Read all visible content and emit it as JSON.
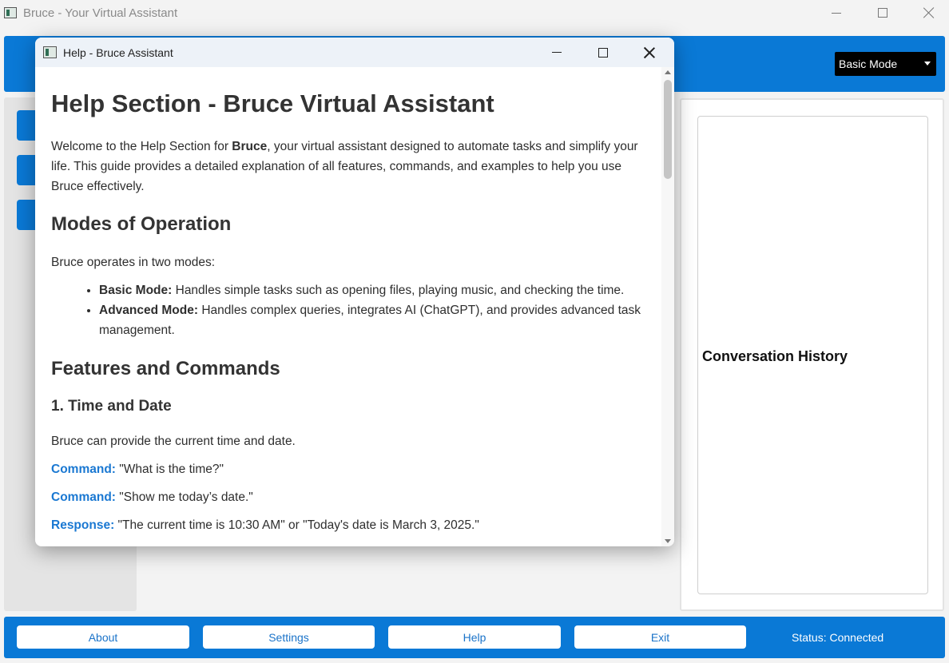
{
  "main_window": {
    "title": "Bruce - Your Virtual Assistant"
  },
  "header": {
    "mode_select": {
      "selected": "Basic Mode"
    }
  },
  "sidebar": {
    "buttons": [
      "",
      "",
      ""
    ]
  },
  "conversation": {
    "title": "Conversation History"
  },
  "bottom_bar": {
    "about": "About",
    "settings": "Settings",
    "help": "Help",
    "exit": "Exit",
    "status": "Status: Connected"
  },
  "help_dialog": {
    "title": "Help - Bruce Assistant",
    "heading": "Help Section - Bruce Virtual Assistant",
    "intro_pre": "Welcome to the Help Section for ",
    "intro_bold": "Bruce",
    "intro_post": ", your virtual assistant designed to automate tasks and simplify your life. This guide provides a detailed explanation of all features, commands, and examples to help you use Bruce effectively.",
    "modes_heading": "Modes of Operation",
    "modes_intro": "Bruce operates in two modes:",
    "modes": [
      {
        "label": "Basic Mode:",
        "text": " Handles simple tasks such as opening files, playing music, and checking the time."
      },
      {
        "label": "Advanced Mode:",
        "text": " Handles complex queries, integrates AI (ChatGPT), and provides advanced task management."
      }
    ],
    "features_heading": "Features and Commands",
    "section1_heading": "1. Time and Date",
    "section1_intro": "Bruce can provide the current time and date.",
    "commands": [
      {
        "label": "Command:",
        "text": " \"What is the time?\""
      },
      {
        "label": "Command:",
        "text": " \"Show me today’s date.\""
      },
      {
        "label": "Response:",
        "text": " \"The current time is 10:30 AM\" or \"Today's date is March 3, 2025.\""
      }
    ]
  },
  "colors": {
    "accent": "#0a79d6",
    "command_label": "#1a78d2"
  }
}
